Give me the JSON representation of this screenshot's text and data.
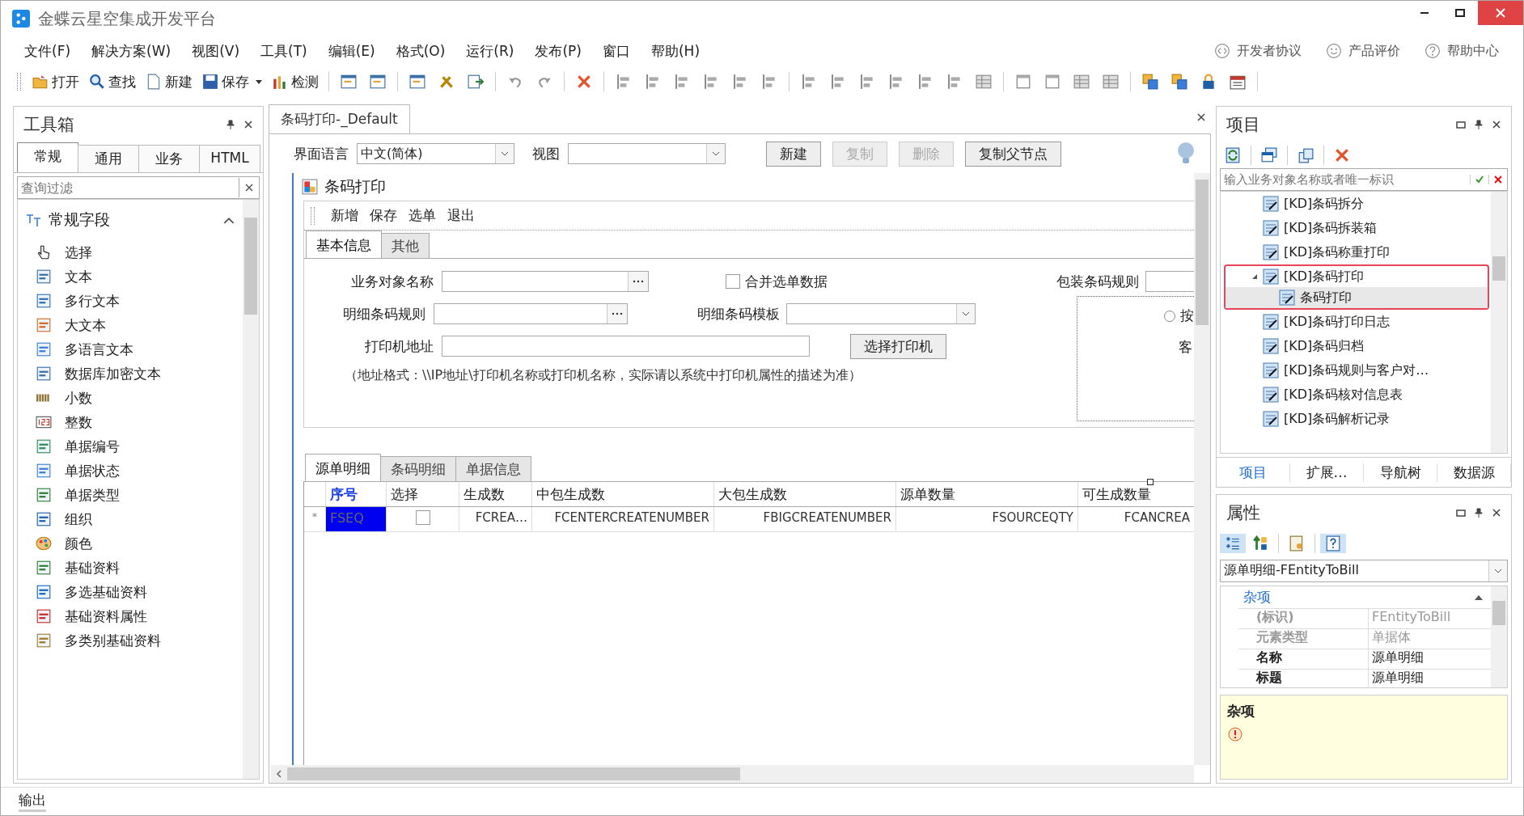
{
  "window": {
    "title": "金蝶云星空集成开发平台"
  },
  "menu": [
    {
      "label": "文件(F)"
    },
    {
      "label": "解决方案(W)"
    },
    {
      "label": "视图(V)"
    },
    {
      "label": "工具(T)"
    },
    {
      "label": "编辑(E)"
    },
    {
      "label": "格式(O)"
    },
    {
      "label": "运行(R)"
    },
    {
      "label": "发布(P)"
    },
    {
      "label": "窗口"
    },
    {
      "label": "帮助(H)"
    }
  ],
  "header_links": [
    {
      "label": "开发者协议",
      "kind": "code"
    },
    {
      "label": "产品评价",
      "kind": "smile"
    },
    {
      "label": "帮助中心",
      "kind": "help"
    }
  ],
  "toolbar": [
    {
      "label": "打开",
      "kind": "open",
      "dropdown": false
    },
    {
      "label": "查找",
      "kind": "search",
      "dropdown": false
    },
    {
      "label": "新建",
      "kind": "new",
      "dropdown": false
    },
    {
      "label": "保存",
      "kind": "save",
      "dropdown": true
    },
    {
      "label": "检测",
      "kind": "check",
      "dropdown": false
    }
  ],
  "toolbox": {
    "title": "工具箱",
    "tabs": [
      {
        "label": "常规",
        "selected": true
      },
      {
        "label": "通用",
        "selected": false
      },
      {
        "label": "业务",
        "selected": false
      },
      {
        "label": "HTML",
        "selected": false
      }
    ],
    "search": {
      "placeholder": "查询过滤"
    },
    "group": {
      "label": "常规字段",
      "expanded": true
    },
    "items": [
      {
        "label": "选择",
        "kind": "pointer"
      },
      {
        "label": "文本",
        "kind": "text"
      },
      {
        "label": "多行文本",
        "kind": "multiline"
      },
      {
        "label": "大文本",
        "kind": "bigtext"
      },
      {
        "label": "多语言文本",
        "kind": "lang"
      },
      {
        "label": "数据库加密文本",
        "kind": "text"
      },
      {
        "label": "小数",
        "kind": "decimal"
      },
      {
        "label": "整数",
        "kind": "integer"
      },
      {
        "label": "单据编号",
        "kind": "billno"
      },
      {
        "label": "单据状态",
        "kind": "status"
      },
      {
        "label": "单据类型",
        "kind": "basedata"
      },
      {
        "label": "组织",
        "kind": "org"
      },
      {
        "label": "颜色",
        "kind": "color"
      },
      {
        "label": "基础资料",
        "kind": "basedata"
      },
      {
        "label": "多选基础资料",
        "kind": "multibase"
      },
      {
        "label": "基础资料属性",
        "kind": "baseprop"
      },
      {
        "label": "多类别基础资料",
        "kind": "multitype"
      }
    ]
  },
  "document": {
    "tab": {
      "label": "条码打印-_Default",
      "selected": true
    },
    "language": {
      "label": "界面语言",
      "value": "中文(简体)"
    },
    "view": {
      "label": "视图"
    },
    "buttons": [
      {
        "label": "新建",
        "disabled": false
      },
      {
        "label": "复制",
        "disabled": true
      },
      {
        "label": "删除",
        "disabled": true
      },
      {
        "label": "复制父节点",
        "disabled": false
      }
    ],
    "form_title": "条码打印",
    "form_actions": [
      {
        "label": "新增"
      },
      {
        "label": "保存"
      },
      {
        "label": "选单"
      },
      {
        "label": "退出"
      }
    ],
    "form_tabs": [
      {
        "label": "基本信息",
        "selected": true
      },
      {
        "label": "其他",
        "selected": false
      }
    ],
    "fields": {
      "business_object": "业务对象名称",
      "merge": {
        "label": "合并选单数据",
        "checked": false
      },
      "package_rule": "包装条码规则",
      "detail_rule": "明细条码规则",
      "detail_template": "明细条码模板",
      "printer_address": "打印机地址",
      "choose_printer": "选择打印机",
      "note": "（地址格式：\\\\IP地址\\打印机名称或打印机名称，实际请以系统中打印机属性的描述为准）",
      "radio": {
        "label": "按",
        "checked": false
      },
      "customer": "客"
    },
    "grid_tabs": [
      {
        "label": "源单明细",
        "selected": true
      },
      {
        "label": "条码明细",
        "selected": false
      },
      {
        "label": "单据信息",
        "selected": false
      }
    ],
    "table": {
      "columns": [
        {
          "label": "序号",
          "key": true
        },
        {
          "label": "选择",
          "key": false
        },
        {
          "label": "生成数",
          "key": false
        },
        {
          "label": "中包生成数",
          "key": false
        },
        {
          "label": "大包生成数",
          "key": false
        },
        {
          "label": "源单数量",
          "key": false
        },
        {
          "label": "可生成数量",
          "key": false
        }
      ],
      "rows": [
        {
          "marker": "*",
          "seq_selected": true,
          "checked": false,
          "cells": [
            "FSEQ",
            "",
            "FCREA…",
            "FCENTERCREATENUMBER",
            "FBIGCREATENUMBER",
            "FSOURCEQTY",
            "FCANCREA"
          ]
        }
      ]
    }
  },
  "project": {
    "title": "项目",
    "search": {
      "placeholder": "输入业务对象名称或者唯一标识"
    },
    "tree": [
      {
        "label": "[KD]条码拆分",
        "selected": false,
        "highlighted": false
      },
      {
        "label": "[KD]条码拆装箱",
        "selected": false,
        "highlighted": false
      },
      {
        "label": "[KD]条码称重打印",
        "selected": false,
        "highlighted": false
      },
      {
        "label": "[KD]条码打印",
        "selected": false,
        "highlighted": true,
        "expanded": true,
        "children": [
          {
            "label": "条码打印",
            "selected": true
          }
        ]
      },
      {
        "label": "[KD]条码打印日志",
        "selected": false,
        "highlighted": false
      },
      {
        "label": "[KD]条码归档",
        "selected": false,
        "highlighted": false
      },
      {
        "label": "[KD]条码规则与客户对…",
        "selected": false,
        "highlighted": false
      },
      {
        "label": "[KD]条码核对信息表",
        "selected": false,
        "highlighted": false
      },
      {
        "label": "[KD]条码解析记录",
        "selected": false,
        "highlighted": false
      }
    ],
    "tabs": [
      {
        "label": "项目",
        "selected": true
      },
      {
        "label": "扩展…",
        "selected": false
      },
      {
        "label": "导航树",
        "selected": false
      },
      {
        "label": "数据源",
        "selected": false
      }
    ]
  },
  "properties": {
    "title": "属性",
    "object": "源单明细-FEntityToBill",
    "category": "杂项",
    "rows": [
      {
        "name": "(标识)",
        "value": "FEntityToBill",
        "readonly": true
      },
      {
        "name": "元素类型",
        "value": "单据体",
        "readonly": true
      },
      {
        "name": "名称",
        "value": "源单明细",
        "readonly": false
      },
      {
        "name": "标题",
        "value": "源单明细",
        "readonly": false
      }
    ],
    "description_title": "杂项"
  },
  "output": {
    "label": "输出"
  }
}
